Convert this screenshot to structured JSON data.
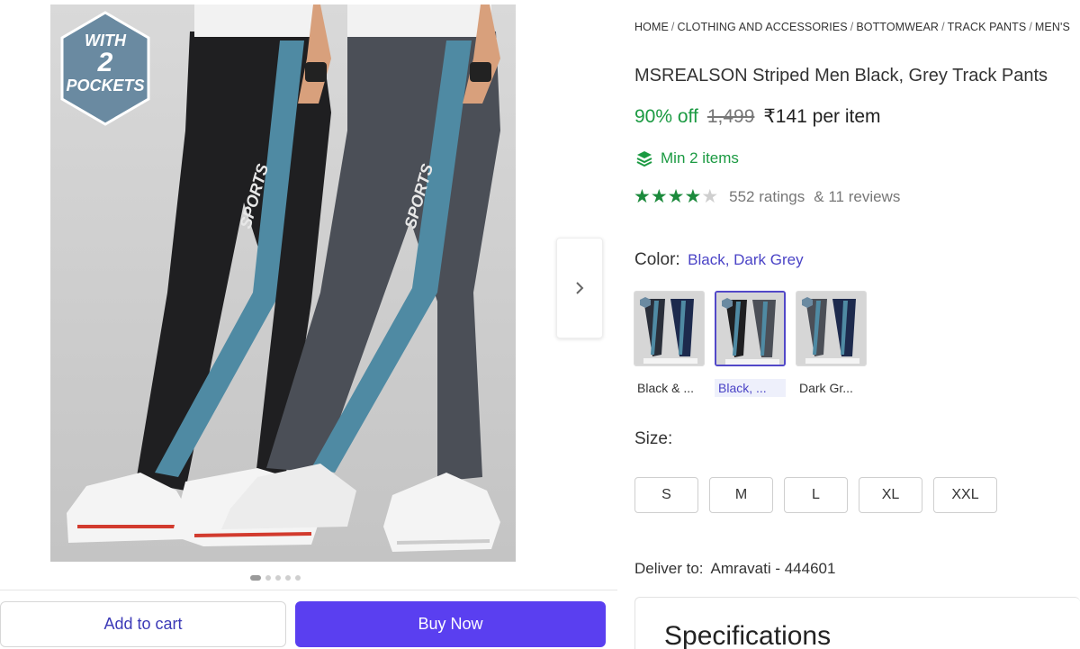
{
  "badge": {
    "line1": "WITH",
    "line2": "2",
    "line3": "POCKETS"
  },
  "carousel": {
    "dot_count": 5,
    "active_index": 0,
    "next_icon": "chevron-right-icon"
  },
  "actions": {
    "add_to_cart": "Add to cart",
    "buy_now": "Buy Now"
  },
  "breadcrumb": [
    "HOME",
    "CLOTHING AND ACCESSORIES",
    "BOTTOMWEAR",
    "TRACK PANTS",
    "MEN'S"
  ],
  "product": {
    "title": "MSREALSON Striped Men Black, Grey Track Pants",
    "discount": "90% off",
    "mrp": "1,499",
    "price": "₹141 per item",
    "min_items": "Min 2 items",
    "rating_stars": 4,
    "rating_count": "552 ratings",
    "review_count": "& 11 reviews"
  },
  "color": {
    "label": "Color:",
    "value": "Black, Dark Grey",
    "options": [
      "Black & ...",
      "Black, ...",
      "Dark Gr..."
    ],
    "selected_index": 1
  },
  "size": {
    "label": "Size:",
    "options": [
      "S",
      "M",
      "L",
      "XL",
      "XXL"
    ]
  },
  "delivery": {
    "label": "Deliver to:",
    "location": "Amravati - 444601"
  },
  "specs": {
    "title": "Specifications"
  },
  "colors": {
    "accent": "#5a3ff0",
    "link": "#4a43c6",
    "green": "#1b9a42",
    "star": "#1c8a3c",
    "stripe": "#4f8aa3",
    "badge": "#6a8aa1"
  }
}
